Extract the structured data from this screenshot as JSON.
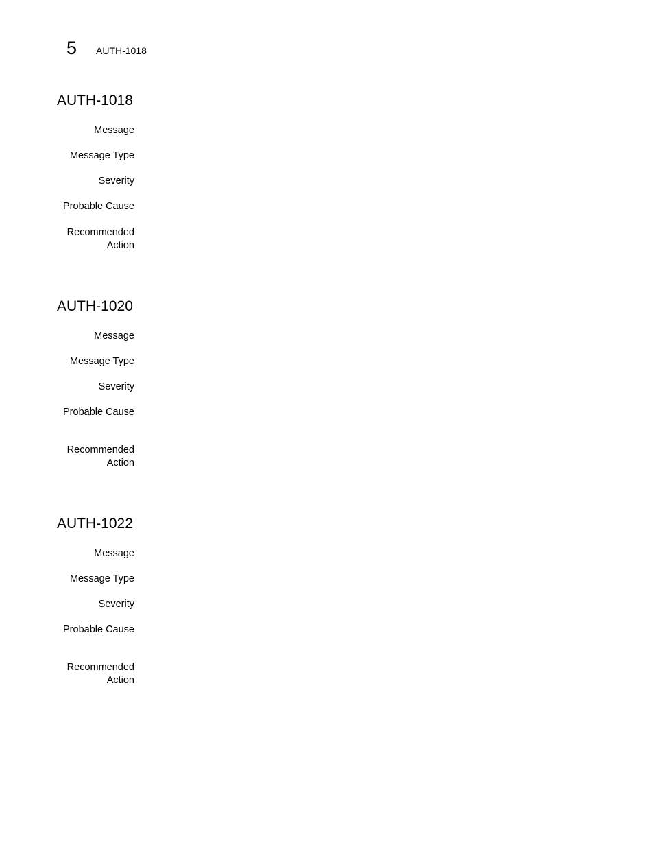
{
  "header": {
    "chapter_number": "5",
    "running_title": "AUTH-1018"
  },
  "sections": [
    {
      "title": "AUTH-1018",
      "fields": [
        {
          "label": "Message",
          "value": ""
        },
        {
          "label": "Message Type",
          "value": ""
        },
        {
          "label": "Severity",
          "value": ""
        },
        {
          "label": "Probable Cause",
          "value": ""
        },
        {
          "label": "Recommended Action",
          "value": ""
        }
      ]
    },
    {
      "title": "AUTH-1020",
      "fields": [
        {
          "label": "Message",
          "value": ""
        },
        {
          "label": "Message Type",
          "value": ""
        },
        {
          "label": "Severity",
          "value": ""
        },
        {
          "label": "Probable Cause",
          "value": ""
        },
        {
          "label": "Recommended Action",
          "value": ""
        }
      ]
    },
    {
      "title": "AUTH-1022",
      "fields": [
        {
          "label": "Message",
          "value": ""
        },
        {
          "label": "Message Type",
          "value": ""
        },
        {
          "label": "Severity",
          "value": ""
        },
        {
          "label": "Probable Cause",
          "value": ""
        },
        {
          "label": "Recommended Action",
          "value": ""
        }
      ]
    }
  ]
}
